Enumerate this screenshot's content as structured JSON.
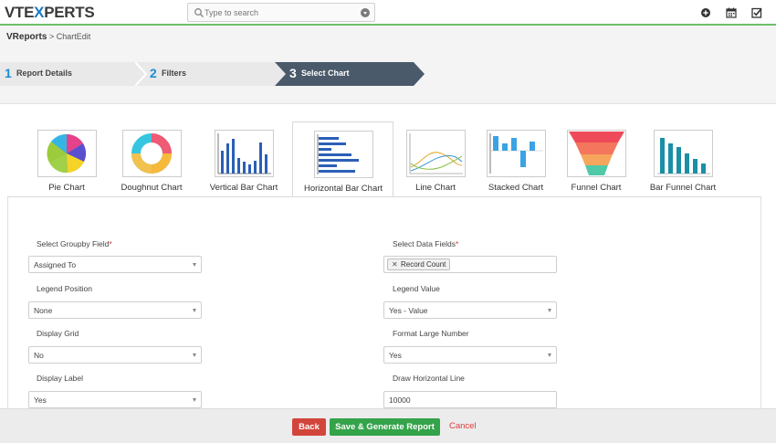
{
  "header": {
    "logo_left": "VTE",
    "logo_x": "X",
    "logo_right": "PERTS",
    "search_placeholder": "Type to search",
    "icons": [
      "plus-circle-icon",
      "calendar-icon",
      "checkbox-icon"
    ]
  },
  "breadcrumb": {
    "root": "VReports",
    "separator": ">",
    "current": "ChartEdit"
  },
  "steps": [
    {
      "num": "1",
      "label": "Report Details"
    },
    {
      "num": "2",
      "label": "Filters"
    },
    {
      "num": "3",
      "label": "Select Chart"
    }
  ],
  "chart_types": [
    {
      "label": "Pie Chart",
      "icon": "pie-chart-icon"
    },
    {
      "label": "Doughnut Chart",
      "icon": "doughnut-chart-icon"
    },
    {
      "label": "Vertical Bar Chart",
      "icon": "vertical-bar-chart-icon"
    },
    {
      "label": "Horizontal Bar Chart",
      "icon": "horizontal-bar-chart-icon",
      "selected": true
    },
    {
      "label": "Line Chart",
      "icon": "line-chart-icon"
    },
    {
      "label": "Stacked Chart",
      "icon": "stacked-chart-icon"
    },
    {
      "label": "Funnel Chart",
      "icon": "funnel-chart-icon"
    },
    {
      "label": "Bar Funnel Chart",
      "icon": "bar-funnel-chart-icon"
    }
  ],
  "form": {
    "groupby_label": "Select Groupby Field",
    "groupby_value": "Assigned To",
    "datafields_label": "Select Data Fields",
    "datafields_chip": "Record Count",
    "legend_position_label": "Legend Position",
    "legend_position_value": "None",
    "legend_value_label": "Legend Value",
    "legend_value_value": "Yes - Value",
    "display_grid_label": "Display Grid",
    "display_grid_value": "No",
    "format_large_label": "Format Large Number",
    "format_large_value": "Yes",
    "display_label_label": "Display Label",
    "display_label_value": "Yes",
    "draw_hline_label": "Draw Horizontal Line",
    "draw_hline_value": "10000",
    "required_mark": "*"
  },
  "footer": {
    "back": "Back",
    "save": "Save & Generate Report",
    "cancel": "Cancel"
  },
  "colors": {
    "accent_blue": "#1a8fd6",
    "step_active": "#4a5a6a",
    "header_line": "#6dbf6a",
    "back_button": "#d2453a",
    "save_button": "#34a34a",
    "cancel_link": "#e03a3a"
  }
}
